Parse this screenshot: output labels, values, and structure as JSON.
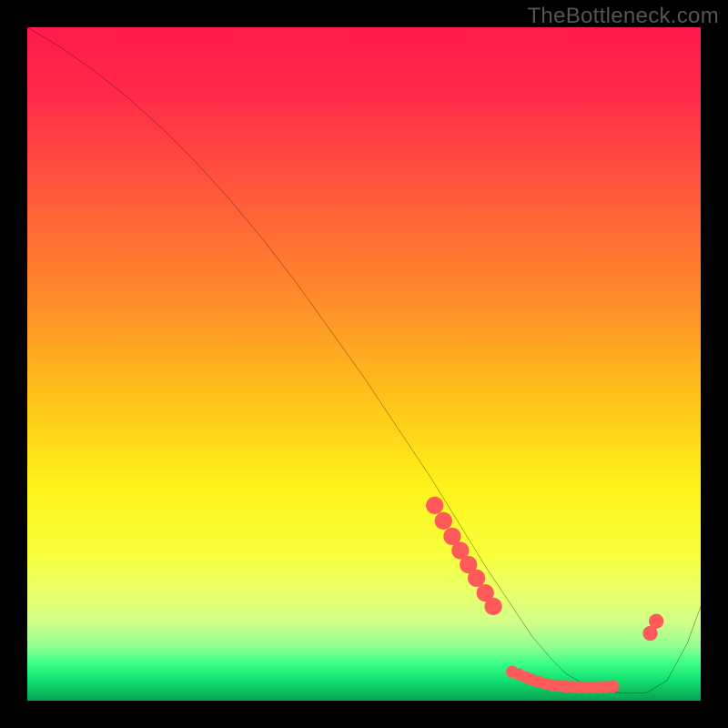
{
  "watermark": "TheBottleneck.com",
  "gradient_stops": [
    {
      "offset": 0.0,
      "color": "#ff1a4b"
    },
    {
      "offset": 0.1,
      "color": "#ff2a49"
    },
    {
      "offset": 0.25,
      "color": "#ff5a3a"
    },
    {
      "offset": 0.4,
      "color": "#ff8a2a"
    },
    {
      "offset": 0.55,
      "color": "#ffc21a"
    },
    {
      "offset": 0.68,
      "color": "#fff21a"
    },
    {
      "offset": 0.78,
      "color": "#f8ff3a"
    },
    {
      "offset": 0.84,
      "color": "#e8ff6a"
    },
    {
      "offset": 0.885,
      "color": "#d0ff8a"
    },
    {
      "offset": 0.92,
      "color": "#90ff90"
    },
    {
      "offset": 0.945,
      "color": "#3aff88"
    },
    {
      "offset": 0.97,
      "color": "#10e070"
    },
    {
      "offset": 1.0,
      "color": "#0aa050"
    }
  ],
  "chart_data": {
    "type": "line",
    "title": "",
    "xlabel": "",
    "ylabel": "",
    "xlim": [
      0,
      100
    ],
    "ylim": [
      0,
      100
    ],
    "series": [
      {
        "name": "curve",
        "x": [
          0,
          5,
          10,
          15,
          20,
          25,
          30,
          35,
          40,
          45,
          50,
          55,
          60,
          64,
          68,
          72,
          75,
          78,
          80,
          83,
          86,
          89,
          92,
          95,
          98,
          100
        ],
        "y": [
          100,
          97,
          93.5,
          89.5,
          85,
          80,
          74.5,
          68.5,
          62,
          55,
          48,
          40.5,
          33,
          26.5,
          20,
          14,
          9.5,
          6,
          4,
          2.3,
          1.4,
          1.1,
          1.2,
          3,
          8.5,
          14
        ]
      }
    ],
    "markers": [
      {
        "x": 60.5,
        "y": 29.0,
        "r": 1.3
      },
      {
        "x": 61.8,
        "y": 26.7,
        "r": 1.3
      },
      {
        "x": 63.1,
        "y": 24.4,
        "r": 1.3
      },
      {
        "x": 64.3,
        "y": 22.3,
        "r": 1.3
      },
      {
        "x": 65.5,
        "y": 20.2,
        "r": 1.3
      },
      {
        "x": 66.7,
        "y": 18.2,
        "r": 1.3
      },
      {
        "x": 68.0,
        "y": 16.0,
        "r": 1.3
      },
      {
        "x": 69.2,
        "y": 14.0,
        "r": 1.3
      },
      {
        "x": 72.0,
        "y": 4.3,
        "r": 0.9
      },
      {
        "x": 73.0,
        "y": 3.9,
        "r": 0.9
      },
      {
        "x": 74.0,
        "y": 3.5,
        "r": 0.9
      },
      {
        "x": 75.0,
        "y": 3.1,
        "r": 0.9
      },
      {
        "x": 76.0,
        "y": 2.8,
        "r": 0.9
      },
      {
        "x": 77.0,
        "y": 2.5,
        "r": 0.9
      },
      {
        "x": 78.0,
        "y": 2.3,
        "r": 0.9
      },
      {
        "x": 79.0,
        "y": 2.2,
        "r": 0.9
      },
      {
        "x": 80.0,
        "y": 2.1,
        "r": 0.9
      },
      {
        "x": 81.0,
        "y": 2.05,
        "r": 0.9
      },
      {
        "x": 82.0,
        "y": 2.0,
        "r": 0.9
      },
      {
        "x": 83.0,
        "y": 2.0,
        "r": 0.9
      },
      {
        "x": 84.0,
        "y": 2.0,
        "r": 0.9
      },
      {
        "x": 85.0,
        "y": 2.0,
        "r": 0.9
      },
      {
        "x": 86.0,
        "y": 2.05,
        "r": 0.9
      },
      {
        "x": 87.0,
        "y": 2.1,
        "r": 0.9
      },
      {
        "x": 92.5,
        "y": 10.0,
        "r": 1.1
      },
      {
        "x": 93.4,
        "y": 11.8,
        "r": 1.1
      }
    ],
    "marker_color": "#ff5a5a",
    "line_color": "#000000",
    "line_width": 2.4
  }
}
